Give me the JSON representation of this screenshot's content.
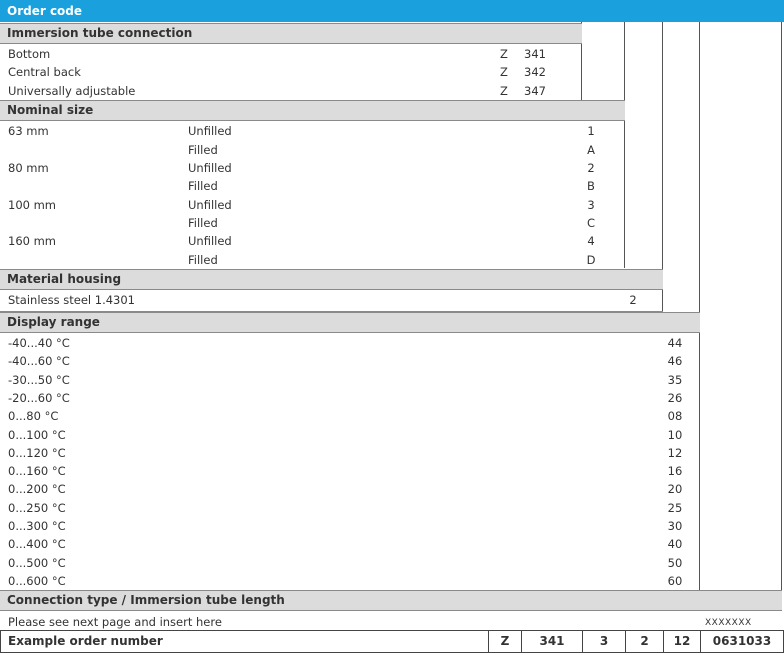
{
  "title": "Order code",
  "immersion": {
    "header": "Immersion tube connection",
    "rows": [
      {
        "label": "Bottom",
        "z": "Z",
        "code": "341"
      },
      {
        "label": "Central back",
        "z": "Z",
        "code": "342"
      },
      {
        "label": "Universally adjustable",
        "z": "Z",
        "code": "347"
      }
    ]
  },
  "nominal": {
    "header": "Nominal size",
    "rows": [
      {
        "size": "63 mm",
        "fill": "Unfilled",
        "code": "1"
      },
      {
        "size": "",
        "fill": "Filled",
        "code": "A"
      },
      {
        "size": "80 mm",
        "fill": "Unfilled",
        "code": "2"
      },
      {
        "size": "",
        "fill": "Filled",
        "code": "B"
      },
      {
        "size": "100 mm",
        "fill": "Unfilled",
        "code": "3"
      },
      {
        "size": "",
        "fill": "Filled",
        "code": "C"
      },
      {
        "size": "160 mm",
        "fill": "Unfilled",
        "code": "4"
      },
      {
        "size": "",
        "fill": "Filled",
        "code": "D"
      }
    ]
  },
  "material": {
    "header": "Material housing",
    "rows": [
      {
        "label": "Stainless steel 1.4301",
        "code": "2"
      }
    ]
  },
  "display": {
    "header": "Display range",
    "rows": [
      {
        "label": "-40...40 °C",
        "code": "44"
      },
      {
        "label": "-40...60 °C",
        "code": "46"
      },
      {
        "label": "-30...50 °C",
        "code": "35"
      },
      {
        "label": "-20...60 °C",
        "code": "26"
      },
      {
        "label": "0...80 °C",
        "code": "08"
      },
      {
        "label": "0...100 °C",
        "code": "10"
      },
      {
        "label": "0...120 °C",
        "code": "12"
      },
      {
        "label": "0...160 °C",
        "code": "16"
      },
      {
        "label": "0...200 °C",
        "code": "20"
      },
      {
        "label": "0...250 °C",
        "code": "25"
      },
      {
        "label": "0...300 °C",
        "code": "30"
      },
      {
        "label": "0...400 °C",
        "code": "40"
      },
      {
        "label": "0...500 °C",
        "code": "50"
      },
      {
        "label": "0...600 °C",
        "code": "60"
      }
    ]
  },
  "connection": {
    "header": "Connection type / Immersion tube length",
    "note": "Please see next page and insert here",
    "code": "XXXXXXX"
  },
  "example": {
    "label": "Example order number",
    "z": "Z",
    "c1": "341",
    "c2": "3",
    "c3": "2",
    "c4": "12",
    "c5": "0631033"
  }
}
